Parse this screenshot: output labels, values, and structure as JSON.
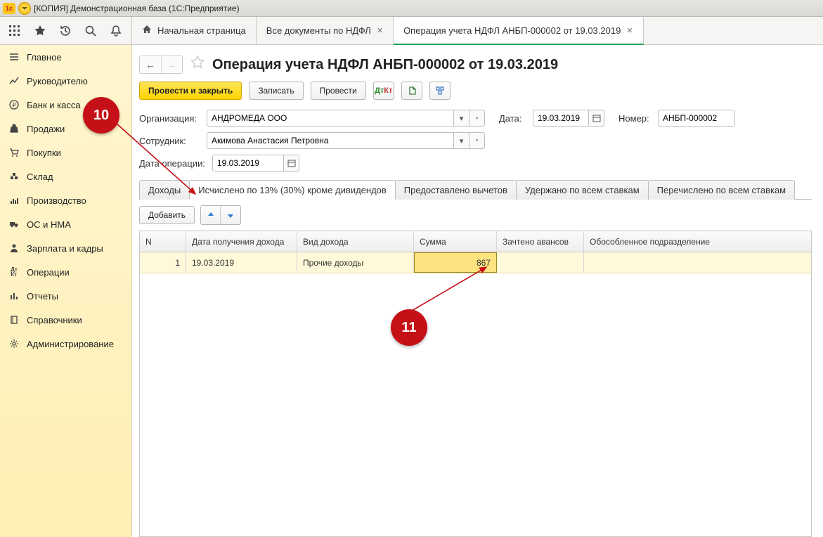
{
  "window": {
    "title": "[КОПИЯ] Демонстрационная база  (1С:Предприятие)"
  },
  "tabs": [
    {
      "label": "Начальная страница"
    },
    {
      "label": "Все документы по НДФЛ"
    },
    {
      "label": "Операция учета НДФЛ АНБП-000002 от 19.03.2019"
    }
  ],
  "sidebar": {
    "items": [
      {
        "label": "Главное"
      },
      {
        "label": "Руководителю"
      },
      {
        "label": "Банк и касса"
      },
      {
        "label": "Продажи"
      },
      {
        "label": "Покупки"
      },
      {
        "label": "Склад"
      },
      {
        "label": "Производство"
      },
      {
        "label": "ОС и НМА"
      },
      {
        "label": "Зарплата и кадры"
      },
      {
        "label": "Операции"
      },
      {
        "label": "Отчеты"
      },
      {
        "label": "Справочники"
      },
      {
        "label": "Администрирование"
      }
    ]
  },
  "doc": {
    "title": "Операция учета НДФЛ АНБП-000002 от 19.03.2019",
    "actions": {
      "post_close": "Провести и закрыть",
      "write": "Записать",
      "post": "Провести"
    },
    "fields": {
      "org_label": "Организация:",
      "org_value": "АНДРОМЕДА ООО",
      "date_label": "Дата:",
      "date_value": "19.03.2019",
      "num_label": "Номер:",
      "num_value": "АНБП-000002",
      "emp_label": "Сотрудник:",
      "emp_value": "Акимова Анастасия Петровна",
      "opdate_label": "Дата операции:",
      "opdate_value": "19.03.2019"
    },
    "inner_tabs": [
      "Доходы",
      "Исчислено по 13% (30%) кроме дивидендов",
      "Предоставлено вычетов",
      "Удержано по всем ставкам",
      "Перечислено по всем ставкам"
    ],
    "add_btn": "Добавить",
    "grid": {
      "headers": {
        "n": "N",
        "date": "Дата получения дохода",
        "type": "Вид дохода",
        "sum": "Сумма",
        "avans": "Зачтено авансов",
        "dep": "Обособленное подразделение"
      },
      "rows": [
        {
          "n": "1",
          "date": "19.03.2019",
          "type": "Прочие доходы",
          "sum": "867",
          "avans": "",
          "dep": ""
        }
      ]
    }
  },
  "annotations": {
    "b10": "10",
    "b11": "11"
  }
}
